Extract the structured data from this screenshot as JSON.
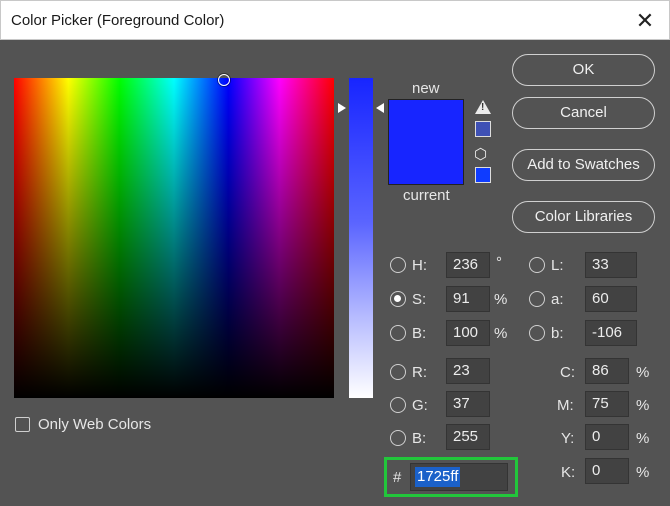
{
  "window": {
    "title": "Color Picker (Foreground Color)",
    "close_glyph": "✕"
  },
  "swatch": {
    "new_label": "new",
    "current_label": "current",
    "new_color": "#1725ff",
    "current_color": "#1725ff"
  },
  "indicators": {
    "gamut_warning_icon": "warning-icon",
    "gamut_color": "#3f51b5",
    "web_icon": "cube-icon",
    "web_color": "#0f3cff"
  },
  "buttons": {
    "ok": "OK",
    "cancel": "Cancel",
    "add_to_swatches": "Add to Swatches",
    "color_libraries": "Color Libraries"
  },
  "hsb": {
    "h": {
      "label": "H:",
      "value": "236",
      "unit": "°"
    },
    "s": {
      "label": "S:",
      "value": "91",
      "unit": "%"
    },
    "b": {
      "label": "B:",
      "value": "100",
      "unit": "%"
    },
    "selected": "S"
  },
  "lab": {
    "l": {
      "label": "L:",
      "value": "33"
    },
    "a": {
      "label": "a:",
      "value": "60"
    },
    "b": {
      "label": "b:",
      "value": "-106"
    }
  },
  "rgb": {
    "r": {
      "label": "R:",
      "value": "23"
    },
    "g": {
      "label": "G:",
      "value": "37"
    },
    "b": {
      "label": "B:",
      "value": "255"
    }
  },
  "cmyk": {
    "c": {
      "label": "C:",
      "value": "86",
      "unit": "%"
    },
    "m": {
      "label": "M:",
      "value": "75",
      "unit": "%"
    },
    "y": {
      "label": "Y:",
      "value": "0",
      "unit": "%"
    },
    "k": {
      "label": "K:",
      "value": "0",
      "unit": "%"
    }
  },
  "hex": {
    "label": "#",
    "value": "1725ff"
  },
  "options": {
    "only_web_colors": "Only Web Colors",
    "only_web_colors_checked": false
  },
  "colors": {
    "dialog_bg": "#535353",
    "highlight_border": "#22c63b",
    "selection": "#1b61c9"
  }
}
